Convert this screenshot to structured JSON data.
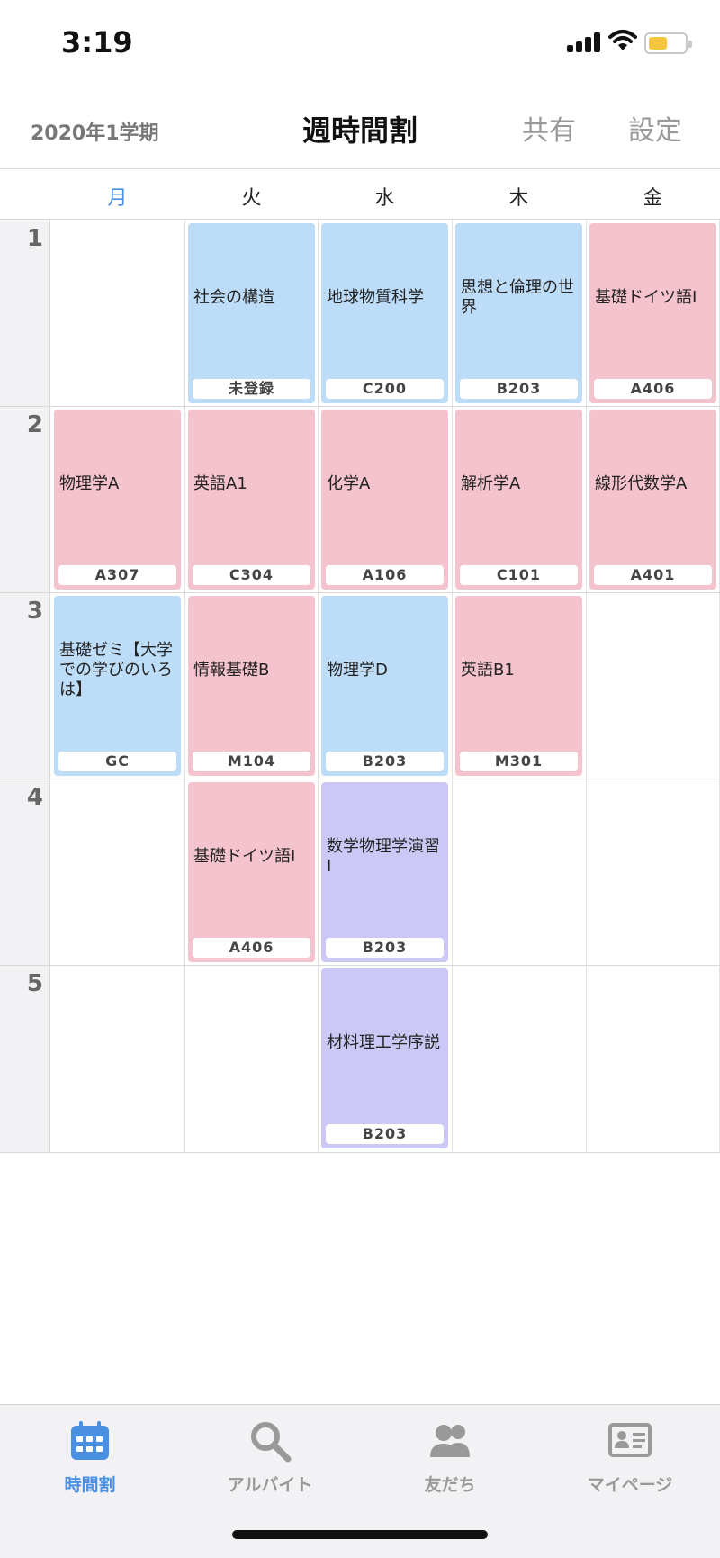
{
  "status": {
    "time": "3:19"
  },
  "header": {
    "term": "2020年1学期",
    "title": "週時間割",
    "share": "共有",
    "settings": "設定"
  },
  "days": [
    "月",
    "火",
    "水",
    "木",
    "金"
  ],
  "periods": [
    "1",
    "2",
    "3",
    "4",
    "5"
  ],
  "courses": [
    {
      "name": "社会の構造",
      "room": "未登録"
    },
    {
      "name": "地球物質科学",
      "room": "C200"
    },
    {
      "name": "思想と倫理の世界",
      "room": "B203"
    },
    {
      "name": "基礎ドイツ語I",
      "room": "A406"
    },
    {
      "name": "物理学A",
      "room": "A307"
    },
    {
      "name": "英語A1",
      "room": "C304"
    },
    {
      "name": "化学A",
      "room": "A106"
    },
    {
      "name": "解析学A",
      "room": "C101"
    },
    {
      "name": "線形代数学A",
      "room": "A401"
    },
    {
      "name": "基礎ゼミ【大学での学びのいろは】",
      "room": "GC"
    },
    {
      "name": "情報基礎B",
      "room": "M104"
    },
    {
      "name": "物理学D",
      "room": "B203"
    },
    {
      "name": "英語B1",
      "room": "M301"
    },
    {
      "name": "基礎ドイツ語I",
      "room": "A406"
    },
    {
      "name": "数学物理学演習I",
      "room": "B203"
    },
    {
      "name": "材料理工学序説",
      "room": "B203"
    }
  ],
  "colors": {
    "blue": "#bcdcf8",
    "pink": "#f5c3ce",
    "purple": "#cbc8f5",
    "accent": "#4a90e2"
  },
  "tabs": [
    {
      "label": "時間割",
      "icon": "calendar-icon"
    },
    {
      "label": "アルバイト",
      "icon": "search-icon"
    },
    {
      "label": "友だち",
      "icon": "friends-icon"
    },
    {
      "label": "マイページ",
      "icon": "id-card-icon"
    }
  ]
}
